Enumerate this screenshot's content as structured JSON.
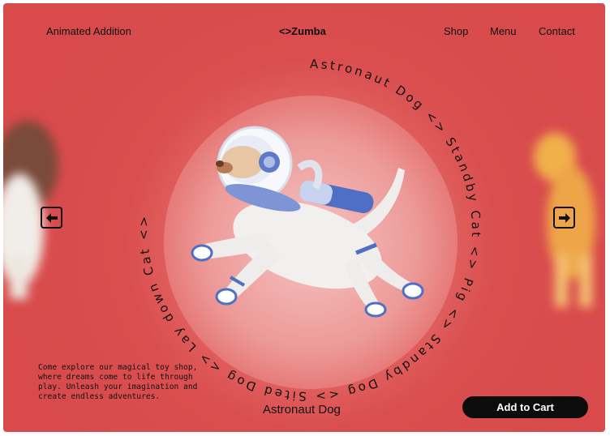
{
  "nav": {
    "left_link": "Animated Addition",
    "brand": "<>Zumba",
    "shop": "Shop",
    "menu": "Menu",
    "contact": "Contact"
  },
  "carousel": {
    "ring_text": "Astronaut Dog <> Standby Cat <> Pig <> Standby Dog <> Sited Dog <> Lay down Cat <> ",
    "prev_icon": "arrow-left-icon",
    "next_icon": "arrow-right-icon"
  },
  "product": {
    "description": "Come explore our magical toy shop, where dreams come to life through play. Unleash your imagination and create endless adventures.",
    "name": "Astronaut Dog",
    "cta": "Add to Cart"
  },
  "colors": {
    "background": "#d84a4b",
    "button": "#0c0c0c"
  }
}
